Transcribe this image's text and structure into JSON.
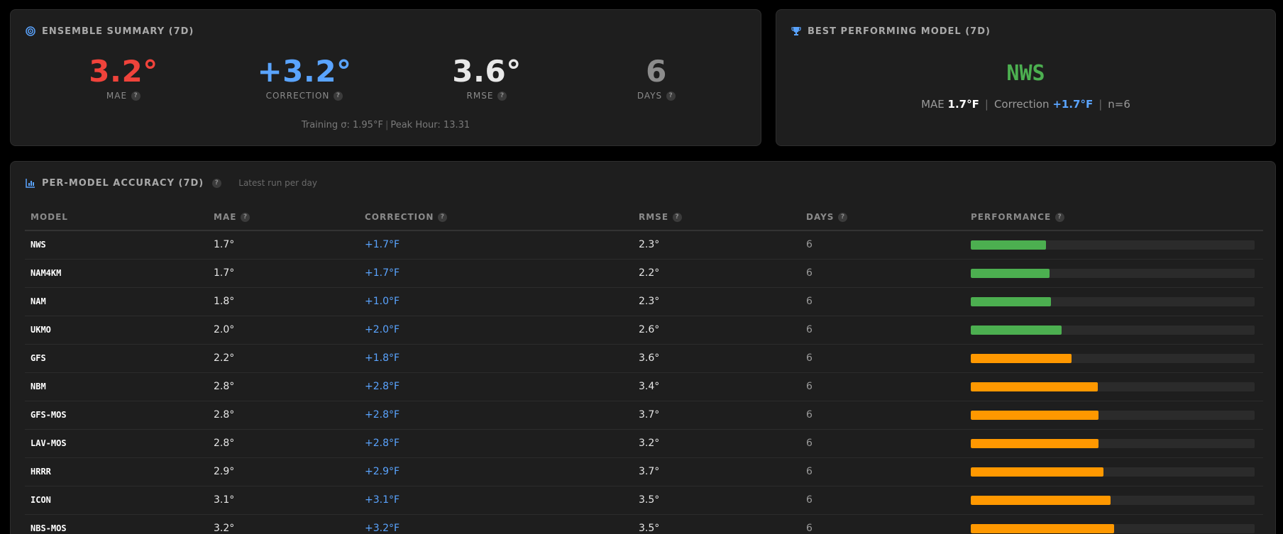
{
  "summary": {
    "title": "ENSEMBLE SUMMARY (7D)",
    "stats": [
      {
        "value": "3.2°",
        "label": "MAE",
        "color": "#f0433b"
      },
      {
        "value": "+3.2°",
        "label": "CORRECTION",
        "color": "#5aa4ff"
      },
      {
        "value": "3.6°",
        "label": "RMSE",
        "color": "#e8e8e8"
      },
      {
        "value": "6",
        "label": "DAYS",
        "color": "#8c8c8c"
      }
    ],
    "training": "Training σ: 1.95°F",
    "peak": "Peak Hour: 13.31"
  },
  "best": {
    "title": "BEST PERFORMING MODEL (7D)",
    "model": "NWS",
    "mae_label": "MAE",
    "mae_value": "1.7°F",
    "correction_label": "Correction",
    "correction_value": "+1.7°F",
    "n": "n=6"
  },
  "accuracy": {
    "title": "PER-MODEL ACCURACY (7D)",
    "subtitle": "Latest run per day",
    "columns": [
      "MODEL",
      "MAE",
      "CORRECTION",
      "RMSE",
      "DAYS",
      "PERFORMANCE"
    ],
    "rows": [
      {
        "model": "NWS",
        "mae": "1.7°",
        "correction": "+1.7°F",
        "rmse": "2.3°",
        "days": "6",
        "performance": 0.265,
        "color": "#4caf50"
      },
      {
        "model": "NAM4KM",
        "mae": "1.7°",
        "correction": "+1.7°F",
        "rmse": "2.2°",
        "days": "6",
        "performance": 0.277,
        "color": "#4caf50"
      },
      {
        "model": "NAM",
        "mae": "1.8°",
        "correction": "+1.0°F",
        "rmse": "2.3°",
        "days": "6",
        "performance": 0.283,
        "color": "#4caf50"
      },
      {
        "model": "UKMO",
        "mae": "2.0°",
        "correction": "+2.0°F",
        "rmse": "2.6°",
        "days": "6",
        "performance": 0.32,
        "color": "#4caf50"
      },
      {
        "model": "GFS",
        "mae": "2.2°",
        "correction": "+1.8°F",
        "rmse": "3.6°",
        "days": "6",
        "performance": 0.355,
        "color": "#ff9800"
      },
      {
        "model": "NBM",
        "mae": "2.8°",
        "correction": "+2.8°F",
        "rmse": "3.4°",
        "days": "6",
        "performance": 0.448,
        "color": "#ff9800"
      },
      {
        "model": "GFS-MOS",
        "mae": "2.8°",
        "correction": "+2.8°F",
        "rmse": "3.7°",
        "days": "6",
        "performance": 0.45,
        "color": "#ff9800"
      },
      {
        "model": "LAV-MOS",
        "mae": "2.8°",
        "correction": "+2.8°F",
        "rmse": "3.2°",
        "days": "6",
        "performance": 0.45,
        "color": "#ff9800"
      },
      {
        "model": "HRRR",
        "mae": "2.9°",
        "correction": "+2.9°F",
        "rmse": "3.7°",
        "days": "6",
        "performance": 0.468,
        "color": "#ff9800"
      },
      {
        "model": "ICON",
        "mae": "3.1°",
        "correction": "+3.1°F",
        "rmse": "3.5°",
        "days": "6",
        "performance": 0.493,
        "color": "#ff9800"
      },
      {
        "model": "NBS-MOS",
        "mae": "3.2°",
        "correction": "+3.2°F",
        "rmse": "3.5°",
        "days": "6",
        "performance": 0.505,
        "color": "#ff9800"
      }
    ]
  },
  "icons": {
    "summary": "target-icon",
    "best": "trophy-icon",
    "accuracy": "bar-chart-icon",
    "help": "help-icon",
    "accent": "#5aa4ff",
    "trophy_color": "#5aa4ff"
  }
}
